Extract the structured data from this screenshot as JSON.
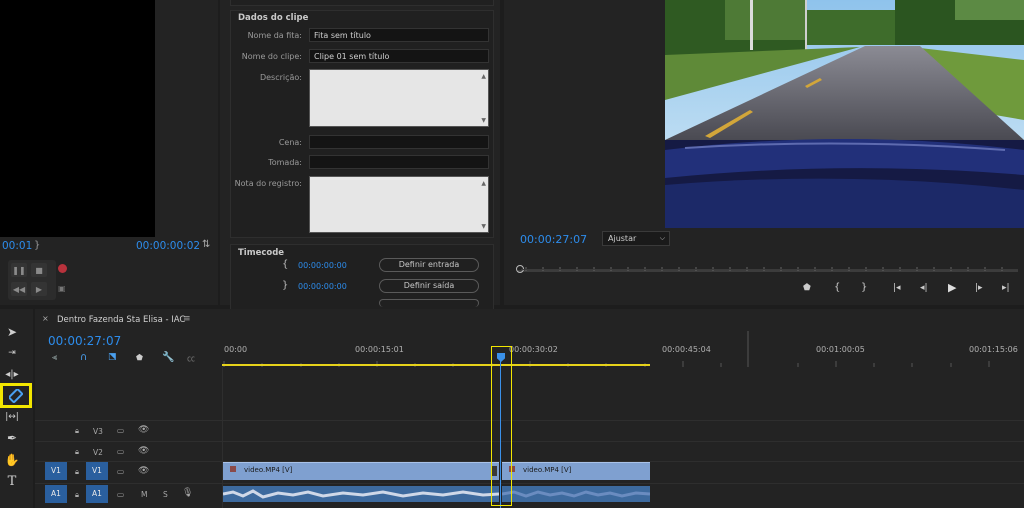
{
  "source_monitor": {
    "timecode_left": "00:01",
    "timecode_right": "00:00:00:02"
  },
  "clip_data": {
    "section_title": "Dados do clipe",
    "tape_name_label": "Nome da fita:",
    "tape_name_value": "Fita sem título",
    "clip_name_label": "Nome do clipe:",
    "clip_name_value": "Clipe 01 sem título",
    "description_label": "Descrição:",
    "scene_label": "Cena:",
    "take_label": "Tomada:",
    "log_note_label": "Nota do registro:"
  },
  "timecode_section": {
    "title": "Timecode",
    "in_value": "00:00:00:00",
    "out_value": "00:00:00:00",
    "set_in_button": "Definir entrada",
    "set_out_button": "Definir saída"
  },
  "program_monitor": {
    "timecode": "00:00:27:07",
    "zoom_select": "Ajustar"
  },
  "timeline": {
    "tab_close": "×",
    "sequence_name": "Dentro Fazenda Sta Elisa - IAC",
    "menu_icon": "≡",
    "playhead_timecode": "00:00:27:07",
    "ruler_labels": [
      "00:00",
      "00:00:15:01",
      "00:00:30:02",
      "00:00:45:04",
      "00:01:00:05",
      "00:01:15:06"
    ],
    "tracks": [
      {
        "name": "V3",
        "source": ""
      },
      {
        "name": "V2",
        "source": ""
      },
      {
        "name": "V1",
        "source": "V1"
      },
      {
        "name": "A1",
        "source": "A1"
      }
    ],
    "audio_m": "M",
    "audio_s": "S",
    "clip_left_video": "video.MP4 [V]",
    "clip_right_video": "video.MP4 [V]"
  },
  "colors": {
    "accent_blue": "#2d8ceb",
    "highlight_yellow": "#f2e600",
    "clip_video": "#7fa0d0",
    "clip_audio": "#3d6a9e"
  },
  "icons": {
    "selection_tool": "arrow-icon",
    "track_select_tool": "track-forward-icon",
    "ripple_tool": "ripple-edit-icon",
    "razor_tool": "razor-icon",
    "slip_tool": "slip-icon",
    "pen_tool": "pen-icon",
    "hand_tool": "hand-icon",
    "type_tool": "type-icon"
  }
}
